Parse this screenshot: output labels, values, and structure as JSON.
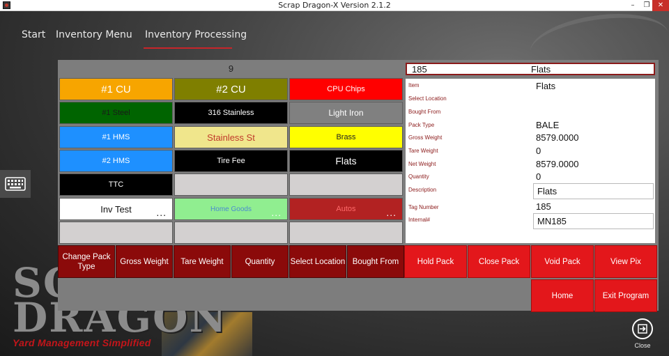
{
  "window": {
    "title": "Scrap Dragon-X  Version 2.1.2"
  },
  "nav": {
    "items": [
      "Start",
      "Inventory Menu",
      "Inventory Processing"
    ],
    "active_index": 2
  },
  "background": {
    "logo_line1": "SCRAP",
    "logo_line2": "DRAGON",
    "logo_tagline": "Yard Management Simplified"
  },
  "grid": {
    "header": "9",
    "tiles": [
      {
        "label": "#1 CU",
        "bg": "#f7a500",
        "fg": "#ffffff",
        "size": "15px"
      },
      {
        "label": "#2 CU",
        "bg": "#7f7f00",
        "fg": "#ffffff",
        "size": "15px"
      },
      {
        "label": "CPU Chips",
        "bg": "#ff0000",
        "fg": "#ffffff",
        "size": "11px"
      },
      {
        "label": "#1 Steel",
        "bg": "#006400",
        "fg": "#1a1a1a",
        "size": "11px"
      },
      {
        "label": "316 Stainless",
        "bg": "#000000",
        "fg": "#ffffff",
        "size": "11px"
      },
      {
        "label": "Light Iron",
        "bg": "#808080",
        "fg": "#ffffff",
        "size": "12px"
      },
      {
        "label": "#1 HMS",
        "bg": "#1e90ff",
        "fg": "#ffffff",
        "size": "11px"
      },
      {
        "label": "Stainless St",
        "bg": "#f0e68c",
        "fg": "#c0392b",
        "size": "13px"
      },
      {
        "label": "Brass",
        "bg": "#ffff00",
        "fg": "#222222",
        "size": "11px"
      },
      {
        "label": "#2 HMS",
        "bg": "#1e90ff",
        "fg": "#ffffff",
        "size": "11px"
      },
      {
        "label": "Tire Fee",
        "bg": "#000000",
        "fg": "#ffffff",
        "size": "11px"
      },
      {
        "label": "Flats",
        "bg": "#000000",
        "fg": "#ffffff",
        "size": "14px"
      },
      {
        "label": "TTC",
        "bg": "#000000",
        "fg": "#ffffff",
        "size": "11px"
      },
      {
        "label": "",
        "bg": "#d3d0d0",
        "fg": "#222222",
        "size": "11px"
      },
      {
        "label": "",
        "bg": "#d3d0d0",
        "fg": "#222222",
        "size": "11px"
      },
      {
        "label": "Inv Test",
        "bg": "#ffffff",
        "fg": "#111111",
        "size": "13px",
        "dots": "..."
      },
      {
        "label": "Home Goods",
        "bg": "#90ee90",
        "fg": "#4a8ad0",
        "size": "10px",
        "dots": "..."
      },
      {
        "label": "Autos",
        "bg": "#b22222",
        "fg": "#ff6a6a",
        "size": "11px",
        "dots": "..."
      },
      {
        "label": "",
        "bg": "#d3d0d0",
        "fg": "#222222",
        "size": "11px"
      },
      {
        "label": "",
        "bg": "#d3d0d0",
        "fg": "#222222",
        "size": "11px"
      },
      {
        "label": "",
        "bg": "#d3d0d0",
        "fg": "#222222",
        "size": "11px"
      }
    ]
  },
  "detail": {
    "header_number": "185",
    "header_name": "Flats",
    "fields": {
      "item": {
        "label": "Item",
        "value": "Flats"
      },
      "select_location": {
        "label": "Select Location",
        "value": ""
      },
      "bought_from": {
        "label": "Bought From",
        "value": ""
      },
      "pack_type": {
        "label": "Pack Type",
        "value": "BALE"
      },
      "gross_weight": {
        "label": "Gross Weight",
        "value": "8579.0000"
      },
      "tare_weight": {
        "label": "Tare Weight",
        "value": "0"
      },
      "net_weight": {
        "label": "Net Weight",
        "value": "8579.0000"
      },
      "quantity": {
        "label": "Quantity",
        "value": "0"
      },
      "description": {
        "label": "Description",
        "value": "Flats"
      },
      "tag_number": {
        "label": "Tag Number",
        "value": "185"
      },
      "internal": {
        "label": "Internal#",
        "value": "MN185"
      }
    }
  },
  "actions": {
    "change_pack_type": "Change Pack Type",
    "gross_weight": "Gross Weight",
    "tare_weight": "Tare Weight",
    "quantity": "Quantity",
    "select_location": "Select Location",
    "bought_from": "Bought From",
    "hold_pack": "Hold Pack",
    "close_pack": "Close Pack",
    "void_pack": "Void Pack",
    "view_pix": "View Pix",
    "home": "Home",
    "exit_program": "Exit Program"
  },
  "close_label": "Close"
}
